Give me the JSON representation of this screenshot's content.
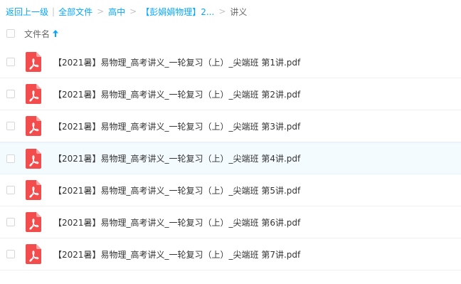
{
  "breadcrumb": {
    "back_label": "返回上一级",
    "all_files_label": "全部文件",
    "level1_label": "高中",
    "level2_label": "【彭娟娟物理】2...",
    "current_label": "讲义",
    "separator": ">"
  },
  "header": {
    "name_column_label": "文件名",
    "sort_icon": "arrow-up-icon"
  },
  "files": [
    {
      "name": "【2021暑】易物理_高考讲义_一轮复习（上）_尖端班 第1讲.pdf",
      "icon": "pdf-icon"
    },
    {
      "name": "【2021暑】易物理_高考讲义_一轮复习（上）_尖端班 第2讲.pdf",
      "icon": "pdf-icon"
    },
    {
      "name": "【2021暑】易物理_高考讲义_一轮复习（上）_尖端班 第3讲.pdf",
      "icon": "pdf-icon"
    },
    {
      "name": "【2021暑】易物理_高考讲义_一轮复习（上）_尖端班 第4讲.pdf",
      "icon": "pdf-icon"
    },
    {
      "name": "【2021暑】易物理_高考讲义_一轮复习（上）_尖端班 第5讲.pdf",
      "icon": "pdf-icon"
    },
    {
      "name": "【2021暑】易物理_高考讲义_一轮复习（上）_尖端班 第6讲.pdf",
      "icon": "pdf-icon"
    },
    {
      "name": "【2021暑】易物理_高考讲义_一轮复习（上）_尖端班 第7讲.pdf",
      "icon": "pdf-icon"
    }
  ],
  "colors": {
    "link": "#06a7ff",
    "pdf_red": "#f24c4c",
    "row_hover": "#f4fbff"
  }
}
